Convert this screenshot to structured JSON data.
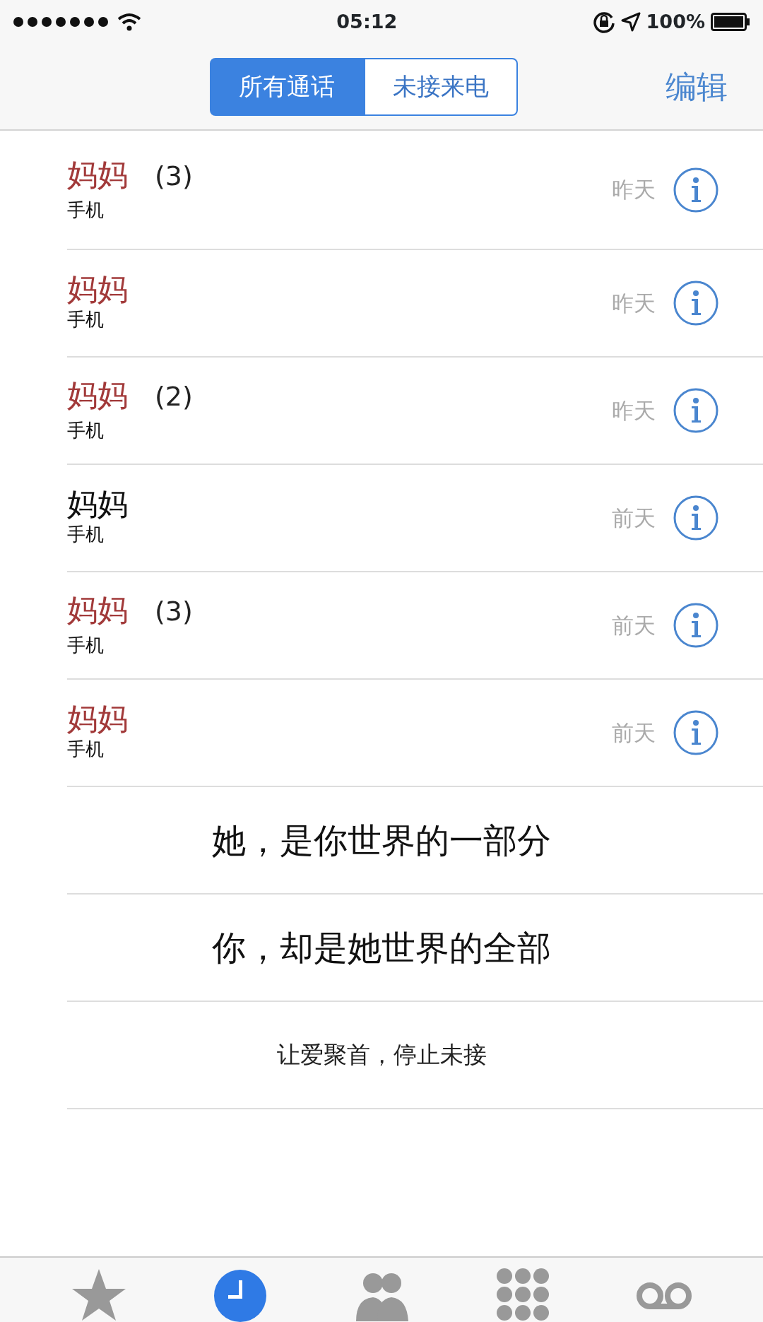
{
  "status_bar": {
    "time": "05:12",
    "battery": "100%"
  },
  "segments": [
    {
      "label": "所有通话",
      "selected": true
    },
    {
      "label": "未接来电",
      "selected": false
    }
  ],
  "edit_button": "编辑",
  "calls": [
    {
      "name": "妈妈",
      "count": "(3)",
      "type": "手机",
      "date": "昨天",
      "missed": true
    },
    {
      "name": "妈妈",
      "type": "手机",
      "date": "昨天",
      "missed": true
    },
    {
      "name": "妈妈",
      "count": "(2)",
      "type": "手机",
      "date": "昨天",
      "missed": true
    },
    {
      "name": "妈妈",
      "type": "手机",
      "date": "前天",
      "missed": false
    },
    {
      "name": "妈妈",
      "count": "(3)",
      "type": "手机",
      "date": "前天",
      "missed": true
    },
    {
      "name": "妈妈",
      "type": "手机",
      "date": "前天",
      "missed": true
    }
  ],
  "messages": [
    {
      "text": "她，是你世界的一部分",
      "kind": "large"
    },
    {
      "text": "你，却是她世界的全部",
      "kind": "large"
    },
    {
      "text": "让爱聚首，停止未接",
      "kind": "small"
    }
  ],
  "tab_bar": [
    {
      "kind": "star",
      "selected": false
    },
    {
      "kind": "clock",
      "selected": true
    },
    {
      "kind": "people",
      "selected": false
    },
    {
      "kind": "keypad",
      "selected": false
    },
    {
      "kind": "voicemail",
      "selected": false
    }
  ]
}
